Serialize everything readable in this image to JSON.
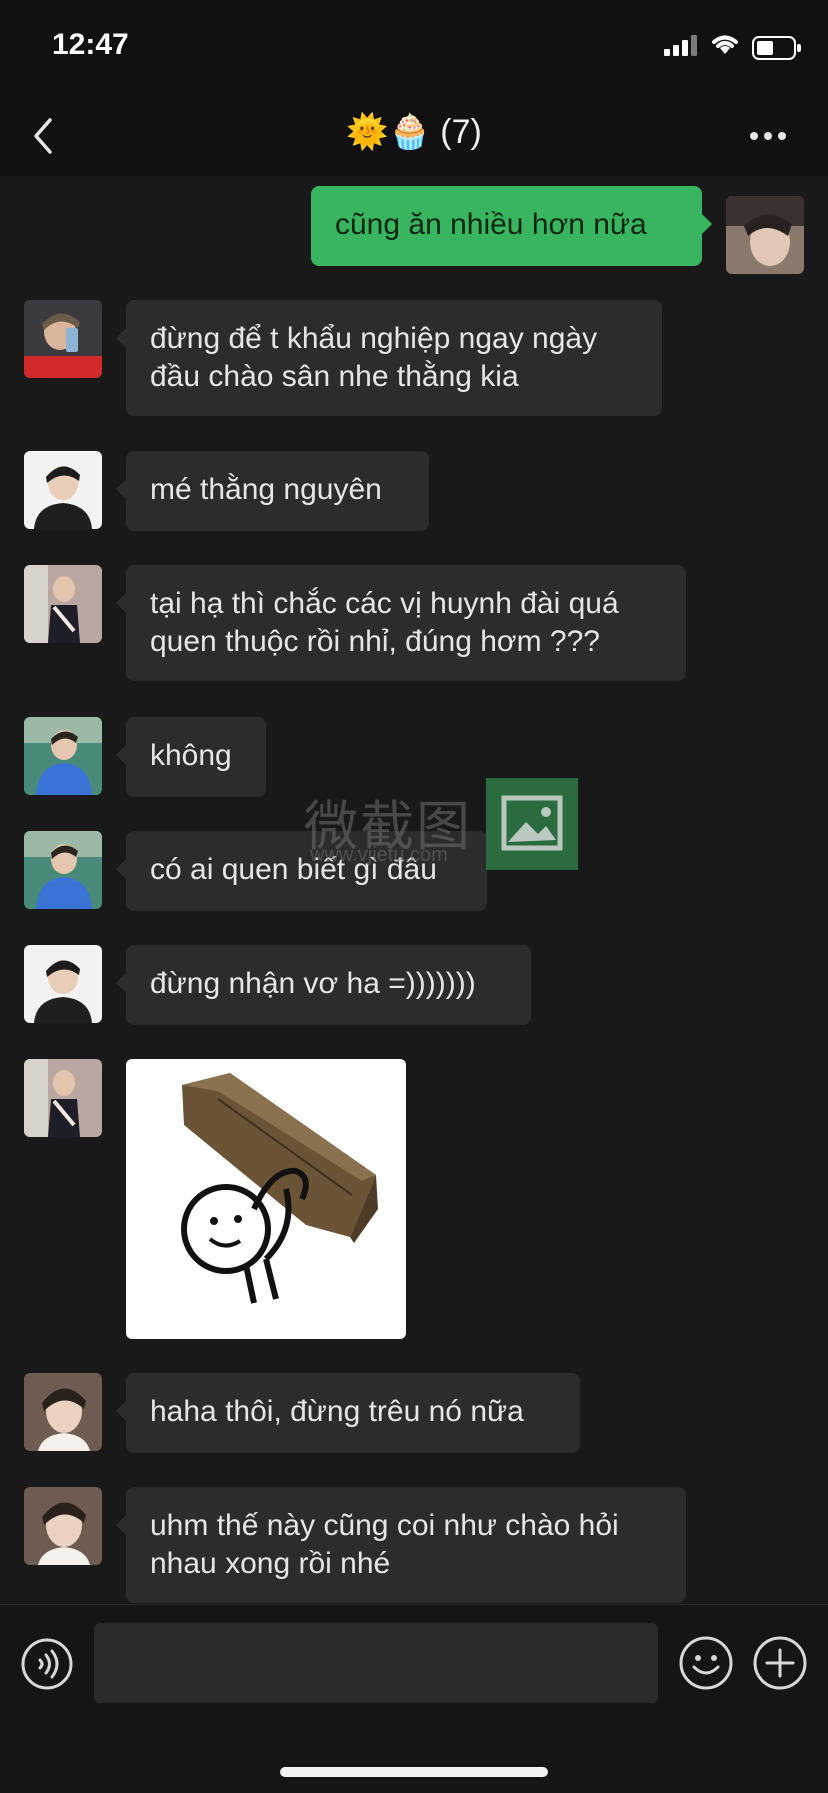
{
  "status": {
    "time": "12:47"
  },
  "header": {
    "title": "🌞🧁 (7)"
  },
  "messages": [
    {
      "from": "me",
      "text": "cũng ăn nhiều hơn nữa"
    },
    {
      "from": "other",
      "text": "đừng để t khẩu nghiệp ngay ngày\nđầu chào sân nhe thằng kia"
    },
    {
      "from": "other",
      "text": "mé thằng nguyên"
    },
    {
      "from": "other",
      "text": "tại hạ thì chắc các vị huynh đài quá\nquen thuộc rồi nhỉ, đúng hơm ???"
    },
    {
      "from": "other",
      "text": "không"
    },
    {
      "from": "other",
      "text": "có ai quen biết gì đâu"
    },
    {
      "from": "other",
      "text": "đừng nhận vơ ha =)))))))"
    },
    {
      "from": "other",
      "type": "sticker",
      "sticker": "coffin-stick-figure"
    },
    {
      "from": "other",
      "text": "haha thôi, đừng trêu nó nữa"
    },
    {
      "from": "other",
      "text": "uhm thế này cũng coi như chào hỏi\nnhau xong rồi nhé"
    }
  ],
  "watermark": {
    "text": "微截图",
    "url": "www.vjietu.com"
  },
  "input": {
    "value": "",
    "placeholder": ""
  },
  "colors": {
    "background": "#191919",
    "bubble_other": "#2c2c2c",
    "bubble_me": "#39b55f",
    "bar": "#111111"
  }
}
